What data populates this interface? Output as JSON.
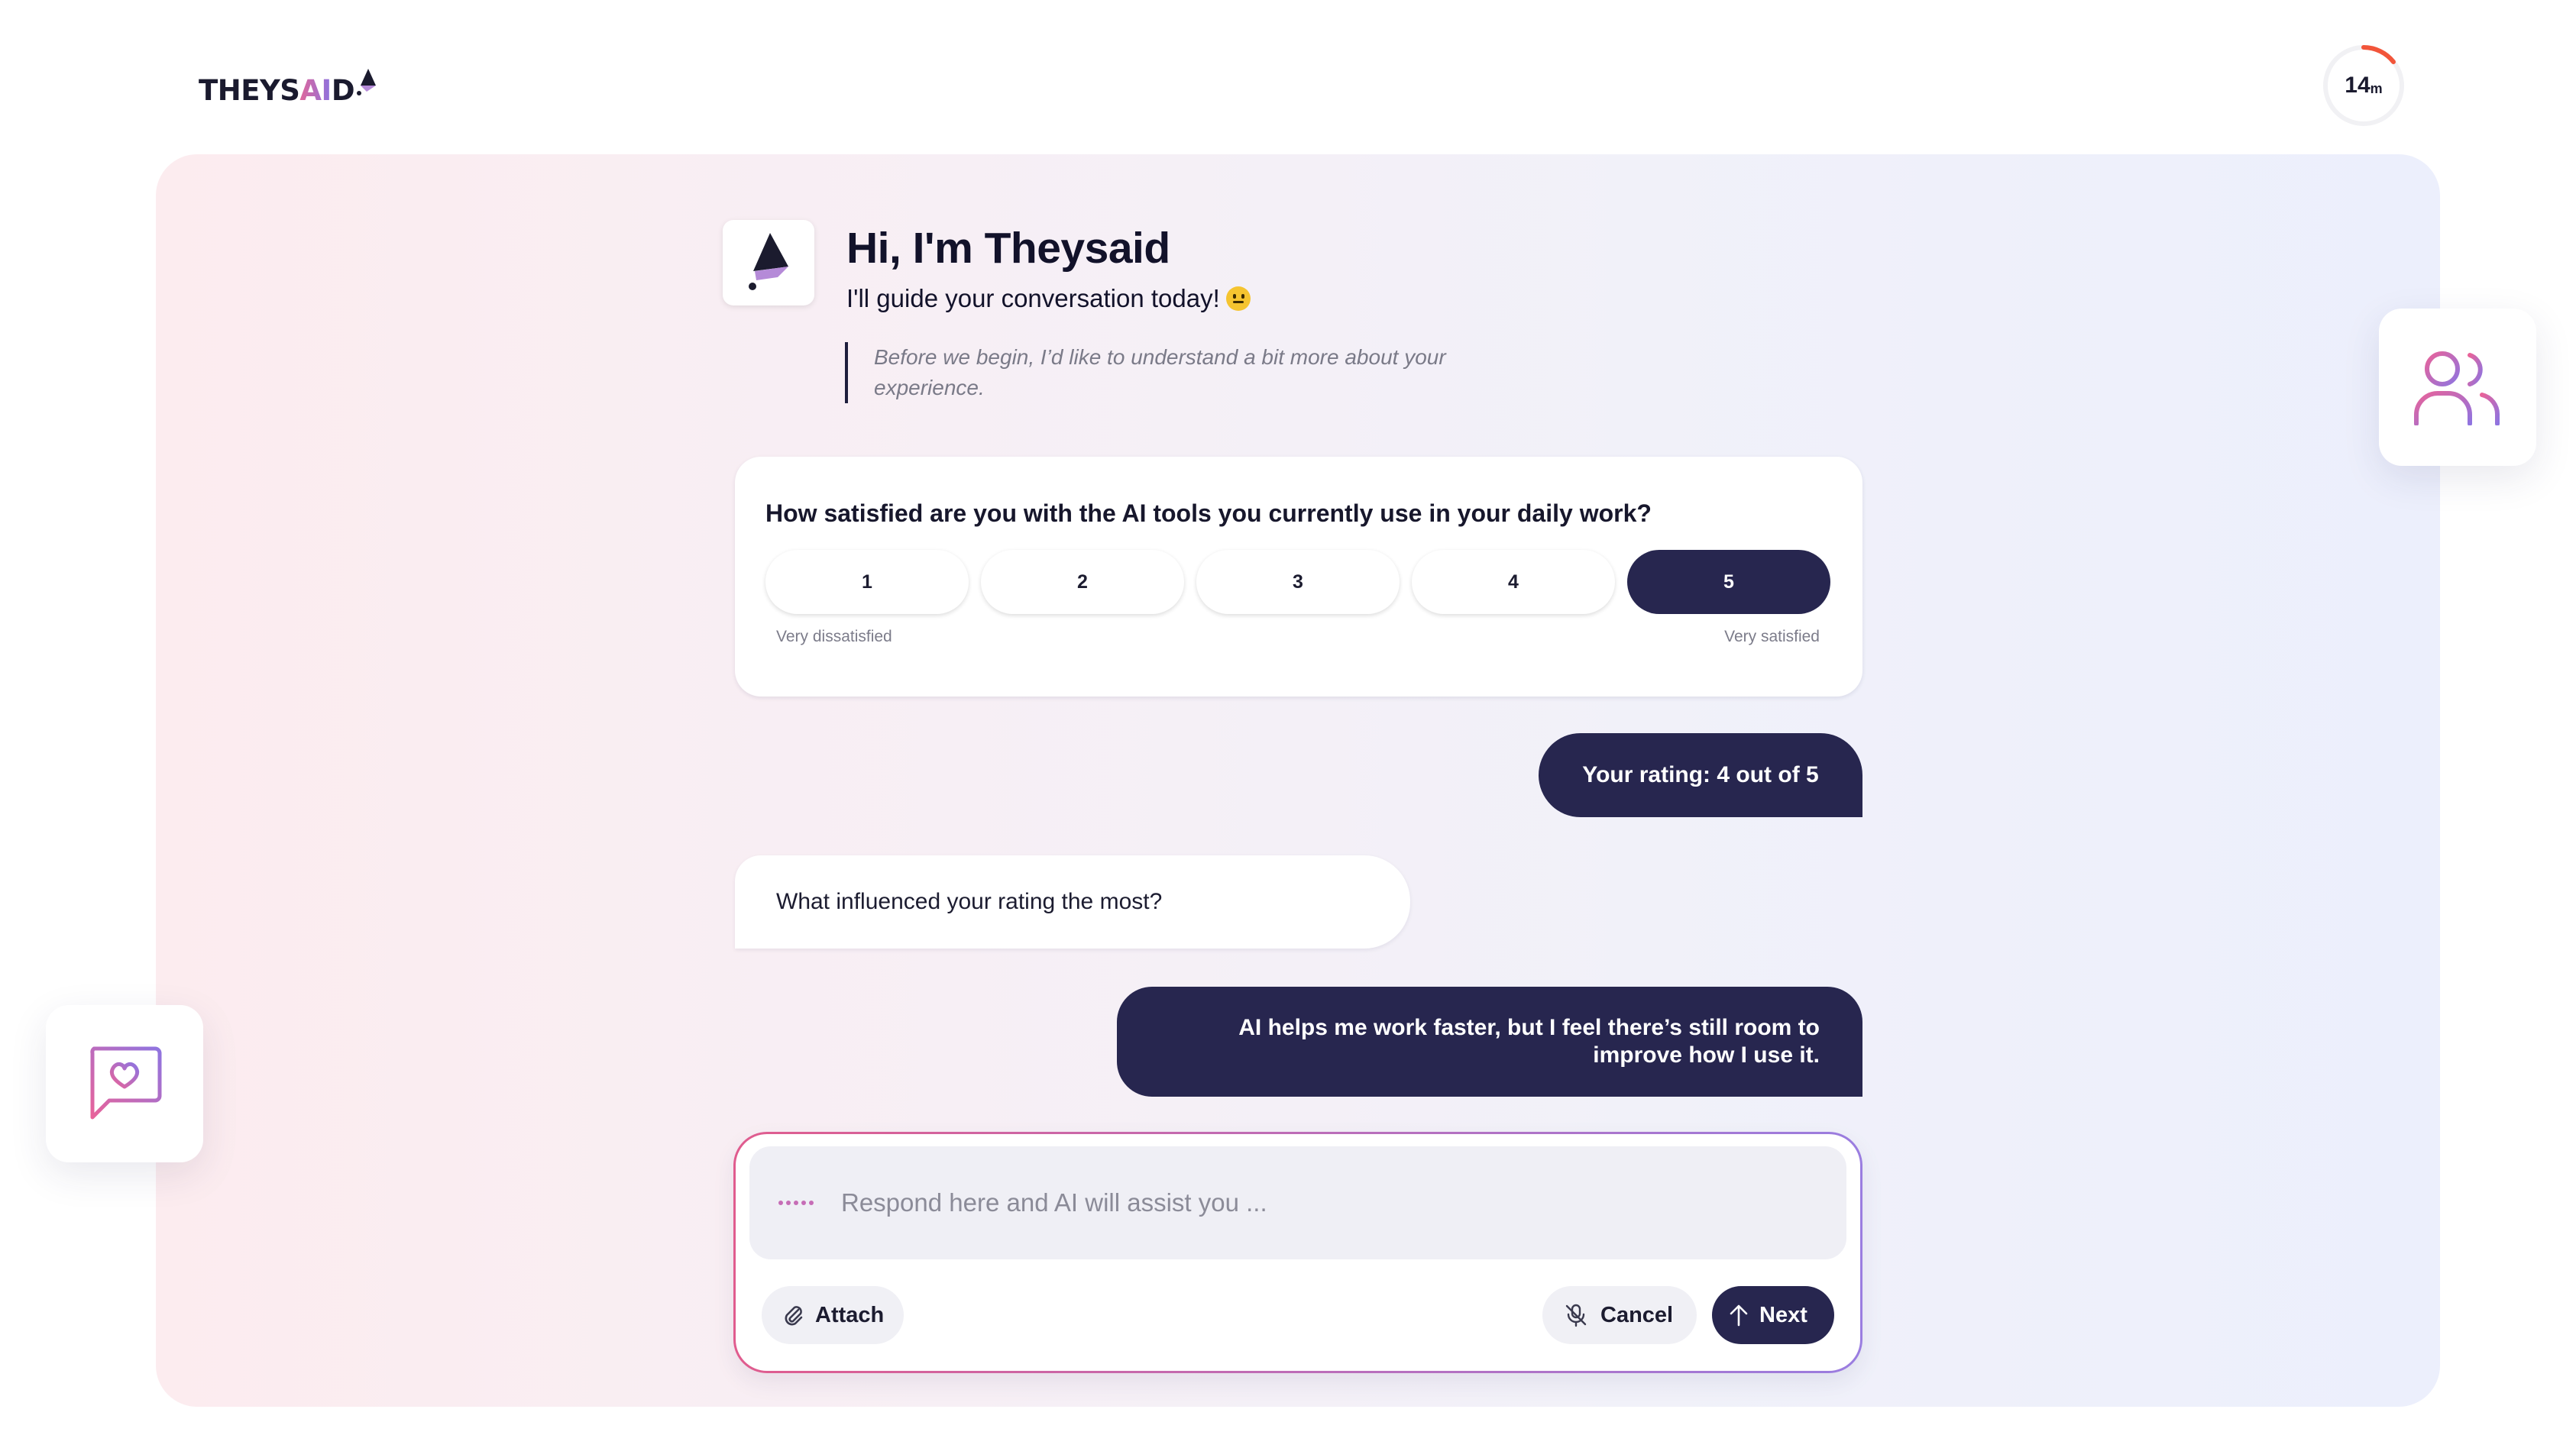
{
  "brand": {
    "name_part1": "THEYS",
    "name_part2": "AI",
    "name_part3": "D"
  },
  "timer": {
    "value": "14",
    "unit": "m",
    "progress": 0.1
  },
  "greeting": {
    "title": "Hi, I'm Theysaid",
    "subtitle": "I'll guide your conversation today!",
    "quote": "Before we begin, I’d like to understand a bit more about your experience."
  },
  "rating_card": {
    "question": "How satisfied are you with the AI tools you currently use in your daily work?",
    "options": [
      "1",
      "2",
      "3",
      "4",
      "5"
    ],
    "selected": "5",
    "min_label": "Very dissatisfied",
    "max_label": "Very satisfied"
  },
  "messages": {
    "user_1": "Your rating: 4 out of 5",
    "ai_1": "What influenced your rating the most?",
    "user_2": "AI helps me work faster, but I feel there’s still room to improve how I use it."
  },
  "composer": {
    "placeholder": "Respond here and AI will assist you ...",
    "value": "",
    "attach_label": "Attach",
    "cancel_label": "Cancel",
    "next_label": "Next"
  },
  "icons": {
    "avatar": "theysaid-cone-icon",
    "side_right": "users-icon",
    "side_left": "chat-heart-icon",
    "attach": "paperclip-icon",
    "cancel": "mic-off-icon",
    "next": "arrow-up-icon"
  },
  "colors": {
    "primary": "#27264f",
    "accent_pink": "#e05c8e",
    "accent_purple": "#9a7de0",
    "timer_accent": "#f2553a"
  }
}
